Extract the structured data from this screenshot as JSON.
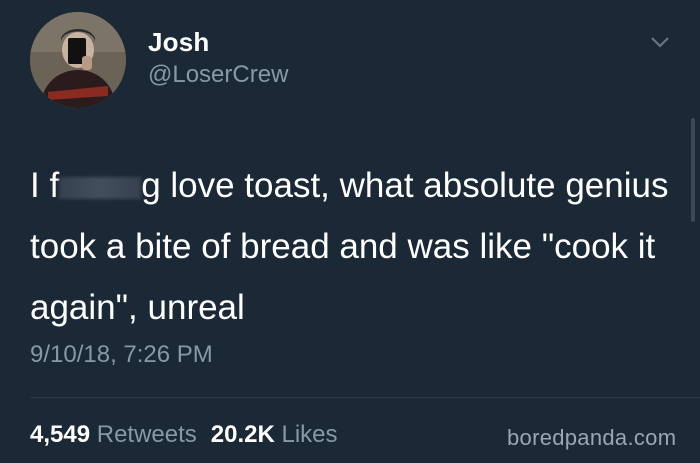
{
  "user": {
    "display_name": "Josh",
    "handle": "@LoserCrew",
    "avatar_icon": "user-avatar"
  },
  "tweet": {
    "text_prefix": "I f",
    "text_suffix": "g love toast, what absolute genius took a bite of bread and was like \"cook it again\", unreal",
    "timestamp": "9/10/18, 7:26 PM"
  },
  "stats": {
    "retweets_count": "4,549",
    "retweets_label": "Retweets",
    "likes_count": "20.2K",
    "likes_label": "Likes"
  },
  "watermark": "boredpanda.com",
  "colors": {
    "background": "#1b2836",
    "text_primary": "#ffffff",
    "text_secondary": "#8899a6"
  }
}
